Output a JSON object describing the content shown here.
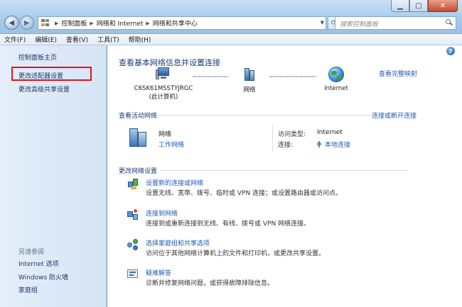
{
  "address_bar": {
    "crumbs": [
      "控制面板",
      "网络和 Internet",
      "网络和共享中心"
    ]
  },
  "search": {
    "placeholder": "搜索控制面板"
  },
  "menu": {
    "items": [
      "文件(F)",
      "编辑(E)",
      "查看(V)",
      "工具(T)",
      "帮助(H)"
    ]
  },
  "sidebar": {
    "home": "控制面板主页",
    "adapter_settings": "更改适配器设置",
    "advanced_sharing": "更改高级共享设置",
    "see_also_title": "另请参阅",
    "see_also": [
      "Internet 选项",
      "Windows 防火墙",
      "家庭组"
    ]
  },
  "main": {
    "title": "查看基本网络信息并设置连接",
    "see_full_map": "查看完整映射",
    "map": {
      "computer_name": "C6SK61MSSTYJRGC",
      "computer_sub": "(此计算机)",
      "network": "网络",
      "internet": "Internet"
    },
    "active_section": "查看活动网络",
    "connect_disconnect": "连接或断开连接",
    "active_network": {
      "name": "网络",
      "type": "工作网络",
      "access_type_label": "访问类型:",
      "access_type_value": "Internet",
      "connections_label": "连接:",
      "connections_value": "本地连接"
    },
    "change_section": "更改网络设置",
    "tasks": [
      {
        "link": "设置新的连接或网络",
        "desc": "设置无线、宽带、拨号、临时或 VPN 连接；或设置路由器或访问点。"
      },
      {
        "link": "连接到网络",
        "desc": "连接到或重新连接到无线、有线、拨号或 VPN 网络连接。"
      },
      {
        "link": "选择家庭组和共享选项",
        "desc": "访问位于其他网络计算机上的文件和打印机，或更改共享设置。"
      },
      {
        "link": "疑难解答",
        "desc": "诊断并修复网络问题，或获得故障排除信息。"
      }
    ]
  }
}
